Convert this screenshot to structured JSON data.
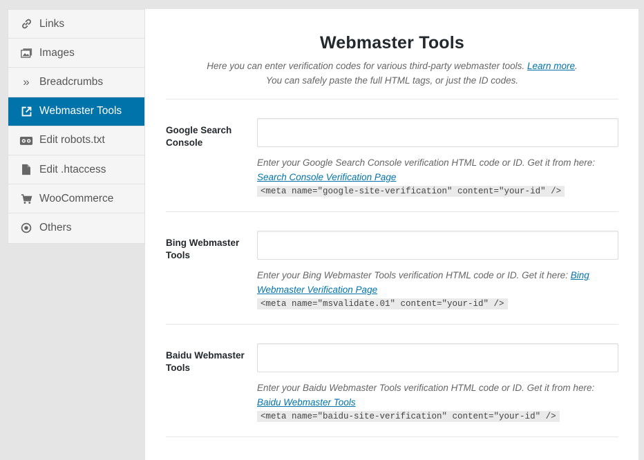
{
  "sidebar": {
    "items": [
      {
        "label": "Links",
        "icon": "link-icon",
        "active": false
      },
      {
        "label": "Images",
        "icon": "images-icon",
        "active": false
      },
      {
        "label": "Breadcrumbs",
        "icon": "breadcrumbs-icon",
        "active": false
      },
      {
        "label": "Webmaster Tools",
        "icon": "external-link-icon",
        "active": true
      },
      {
        "label": "Edit robots.txt",
        "icon": "robot-icon",
        "active": false
      },
      {
        "label": "Edit .htaccess",
        "icon": "file-icon",
        "active": false
      },
      {
        "label": "WooCommerce",
        "icon": "cart-icon",
        "active": false
      },
      {
        "label": "Others",
        "icon": "circle-dot-icon",
        "active": false
      }
    ]
  },
  "main": {
    "title": "Webmaster Tools",
    "intro_line1": "Here you can enter verification codes for various third-party webmaster tools.",
    "intro_link": "Learn more",
    "intro_period": ".",
    "intro_line2": "You can safely paste the full HTML tags, or just the ID codes.",
    "fields": [
      {
        "label": "Google Search Console",
        "value": "",
        "desc": "Enter your Google Search Console verification HTML code or ID. Get it from here:",
        "link": "Search Console Verification Page",
        "code": "<meta name=\"google-site-verification\" content=\"your-id\" />"
      },
      {
        "label": "Bing Webmaster Tools",
        "value": "",
        "desc": "Enter your Bing Webmaster Tools verification HTML code or ID. Get it here:",
        "link": "Bing Webmaster Verification Page",
        "code": "<meta name=\"msvalidate.01\" content=\"your-id\" />"
      },
      {
        "label": "Baidu Webmaster Tools",
        "value": "",
        "desc": "Enter your Baidu Webmaster Tools verification HTML code or ID. Get it from here:",
        "link": "Baidu Webmaster Tools",
        "code": "<meta name=\"baidu-site-verification\" content=\"your-id\" />"
      }
    ]
  },
  "colors": {
    "accent": "#0073aa",
    "background": "#e5e5e5"
  }
}
